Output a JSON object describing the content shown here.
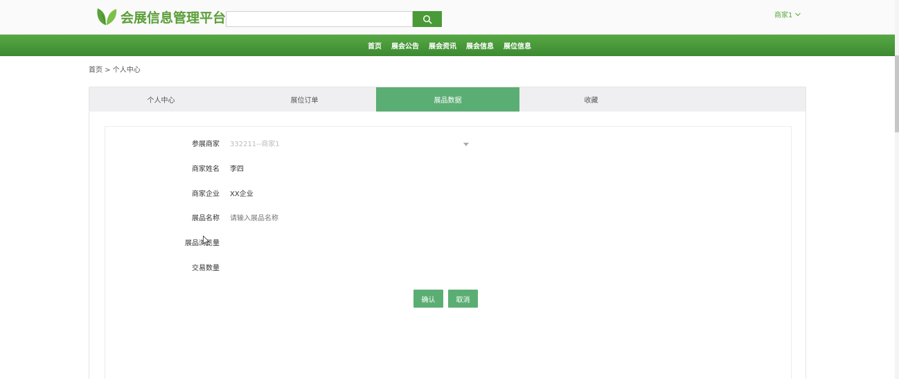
{
  "header": {
    "site_title": "会展信息管理平台",
    "search_placeholder": "",
    "user_label": "商家1"
  },
  "nav": {
    "items": [
      "首页",
      "展会公告",
      "展会资讯",
      "展会信息",
      "展位信息"
    ]
  },
  "breadcrumb": "首页 > 个人中心",
  "tabs": [
    {
      "label": "个人中心",
      "active": false
    },
    {
      "label": "展位订单",
      "active": false
    },
    {
      "label": "展品数据",
      "active": true
    },
    {
      "label": "收藏",
      "active": false
    }
  ],
  "form": {
    "fields": [
      {
        "label": "参展商家",
        "value": "332211--商家1"
      },
      {
        "label": "商家姓名",
        "value": "李四"
      },
      {
        "label": "商家企业",
        "value": "XX企业"
      },
      {
        "label": "展品名称",
        "value": "",
        "placeholder": "请输入展品名称"
      },
      {
        "label": "展品浏览量",
        "value": ""
      },
      {
        "label": "交易数量",
        "value": ""
      }
    ],
    "confirm_label": "确认",
    "cancel_label": "取消"
  },
  "colors": {
    "brand_green": "#4b9a38",
    "tab_active": "#5bae73",
    "nav_bg": "#4a9b3b"
  }
}
